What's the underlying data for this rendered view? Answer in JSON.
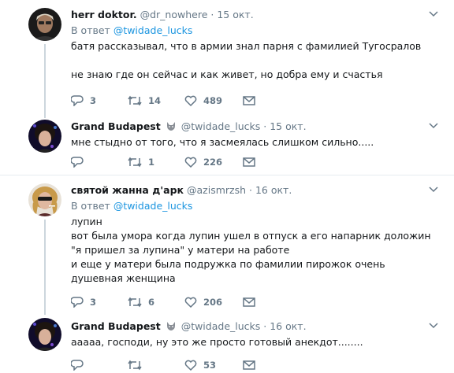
{
  "tweets": [
    {
      "name": "herr doktor.",
      "handle": "@dr_nowhere",
      "dot": "·",
      "time": "15 окт.",
      "reply_prefix": "В ответ",
      "reply_to": "@twidade_lucks",
      "text": "батя рассказывал, что в армии знал парня с фамилией Тугосралов\n\nне знаю где он сейчас и как живет, но добра ему и счастья",
      "replies": "3",
      "retweets": "14",
      "likes": "489"
    },
    {
      "name": "Grand Budapest",
      "handle": "@twidade_lucks",
      "dot": "·",
      "time": "15 окт.",
      "text": "мне стыдно от того, что я засмеялась слишком сильно.....",
      "replies": "",
      "retweets": "1",
      "likes": "226"
    },
    {
      "name": "святой жанна д'арк",
      "handle": "@azismrzsh",
      "dot": "·",
      "time": "16 окт.",
      "reply_prefix": "В ответ",
      "reply_to": "@twidade_lucks",
      "text": "лупин\nвот была умора когда лупин ушел в отпуск а его напарник доложин \"я пришел за лупина\" у матери на работе\nи еще у матери была подружка по фамилии пирожок очень душевная женщина",
      "replies": "3",
      "retweets": "6",
      "likes": "206"
    },
    {
      "name": "Grand Budapest",
      "handle": "@twidade_lucks",
      "dot": "·",
      "time": "16 окт.",
      "text": "ааааа, господи, ну это же просто готовый анекдот........",
      "replies": "",
      "retweets": "",
      "likes": "53"
    }
  ],
  "icons": {
    "reply": "reply-icon",
    "retweet": "retweet-icon",
    "like": "heart-icon",
    "dm": "envelope-icon",
    "more": "chevron-down-icon"
  },
  "colors": {
    "link": "#1b95e0",
    "muted": "#657786",
    "line": "#ccd6dd"
  }
}
